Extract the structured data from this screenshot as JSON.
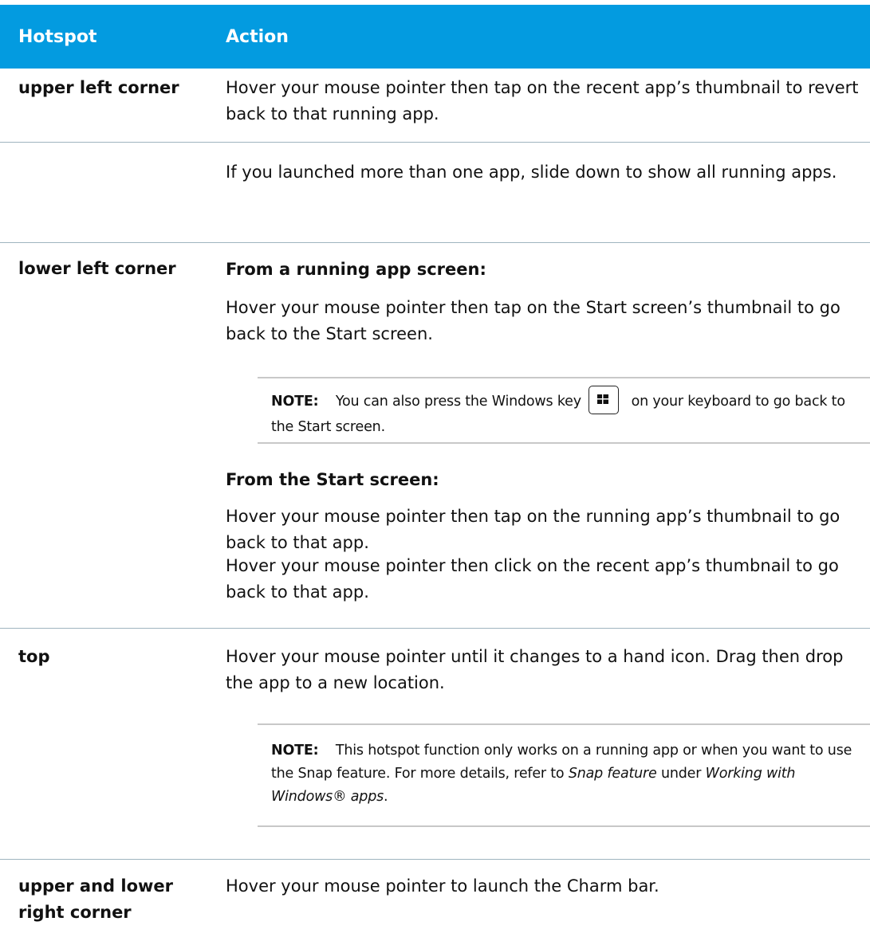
{
  "header": {
    "hotspot_label": "Hotspot",
    "action_label": "Action"
  },
  "rows": {
    "upper_left": {
      "hotspot": "upper left corner",
      "action": "Hover your mouse pointer then tap on the recent app’s thumbnail to revert back to that running app."
    },
    "upper_left_more": {
      "action": "If you launched more than one app, slide down to show all running apps."
    },
    "lower_left": {
      "hotspot": "lower left corner",
      "subhead_running": "From a running app screen:",
      "action_running": "Hover your mouse pointer then tap on the Start screen’s thumbnail to go back to the Start screen.",
      "note": {
        "label": "NOTE:",
        "text_before_key": "You can also press the Windows key",
        "text_after_key": "on your keyboard to go back to the Start screen."
      },
      "subhead_start": "From the Start screen:",
      "action_start_1": "Hover your mouse pointer then tap on the running app’s thumbnail to go back to that app.",
      "action_start_2": "Hover your mouse pointer then click on the recent app’s thumbnail to go back to that app."
    },
    "top": {
      "hotspot": "top",
      "action": "Hover your mouse pointer until it changes to a hand icon. Drag then drop the app to a new location.",
      "note": {
        "label": "NOTE:",
        "text_1": "This hotspot function only works on a running app or when you want to use the Snap feature. For more details, refer to",
        "italic_1": "Snap feature",
        "text_2": "under",
        "italic_2": "Working with Windows® apps",
        "text_3": "."
      }
    },
    "right": {
      "hotspot": "upper and lower right corner",
      "action": "Hover your mouse pointer to launch the Charm bar."
    }
  }
}
